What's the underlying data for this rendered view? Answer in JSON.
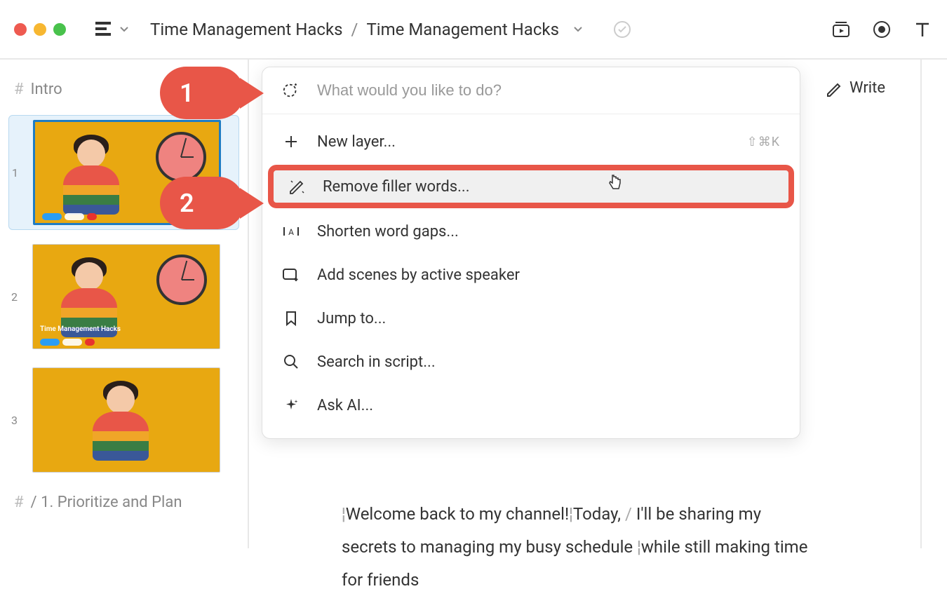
{
  "breadcrumb": {
    "project": "Time Management Hacks",
    "file": "Time Management Hacks"
  },
  "sidebar": {
    "sections": [
      {
        "hash": "#",
        "title": "Intro"
      },
      {
        "hash": "#",
        "title": "/ 1. Prioritize and Plan"
      }
    ],
    "thumbnails": [
      {
        "number": "1"
      },
      {
        "number": "2",
        "caption": "Time Management Hacks"
      },
      {
        "number": "3"
      }
    ]
  },
  "dropdown": {
    "placeholder": "What would you like to do?",
    "items": [
      {
        "label": "New layer...",
        "shortcut": "⇧⌘K"
      },
      {
        "label": "Remove filler words..."
      },
      {
        "label": "Shorten word gaps..."
      },
      {
        "label": "Add scenes by active speaker"
      },
      {
        "label": "Jump to..."
      },
      {
        "label": "Search in script..."
      },
      {
        "label": "Ask AI..."
      }
    ]
  },
  "callouts": {
    "one": "1",
    "two": "2"
  },
  "transcript": {
    "line1a": "Welcome back to my channel!",
    "line1b": "Today, ",
    "line1c": "/",
    "line1d": " I'll be",
    "line2": "sharing my secrets to managing my busy",
    "line3a": "schedule ",
    "line3b": "while still making time for friends"
  },
  "right": {
    "write": "Write"
  }
}
